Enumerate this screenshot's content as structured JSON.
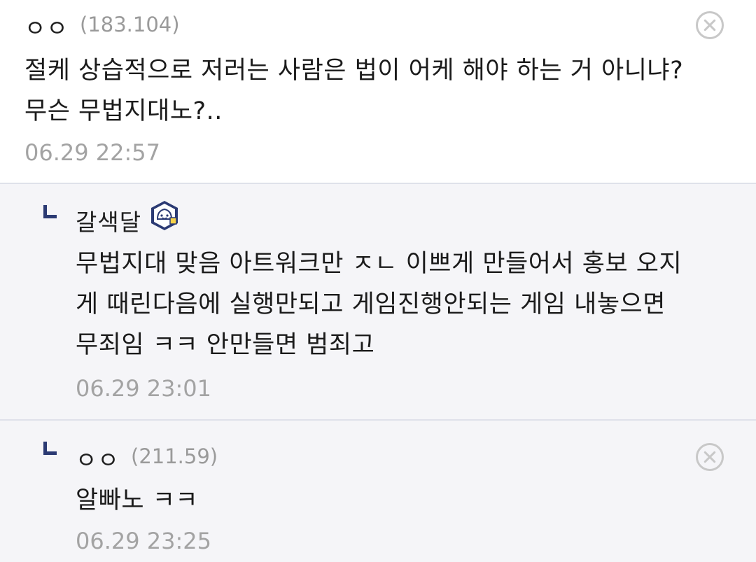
{
  "comments": [
    {
      "nickname": "ㅇㅇ",
      "ip": "(183.104)",
      "text": "절케 상습적으로 저러는 사람은 법이 어케 해야 하는 거 아니냐?\n무슨 무법지대노?..",
      "time": "06.29 22:57",
      "delete_icon": "close-circle-icon"
    },
    {
      "nickname": "갈색달",
      "badge_icon": "fixed-nick-badge-icon",
      "text": "무법지대 맞음 아트워크만 ㅈㄴ 이쁘게 만들어서 홍보 오지\n게 때린다음에 실행만되고 게임진행안되는 게임 내놓으면\n무죄임 ㅋㅋ 안만들면 범죄고",
      "time": "06.29 23:01"
    },
    {
      "nickname": "ㅇㅇ",
      "ip": "(211.59)",
      "text": "알빠노 ㅋㅋ",
      "time": "06.29 23:25",
      "delete_icon": "close-circle-icon"
    }
  ],
  "colors": {
    "reply_background": "#f5f5f8",
    "divider": "#dfe1ea",
    "reply_arrow": "#2b3a73",
    "meta_text": "#9a9a9a"
  }
}
